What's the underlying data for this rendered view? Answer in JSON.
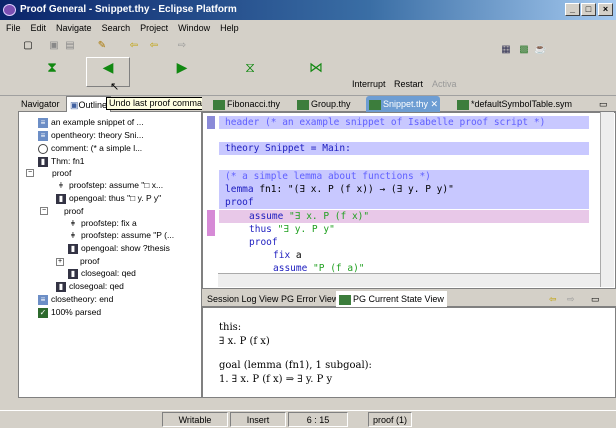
{
  "window": {
    "title": "Proof General - Snippet.thy - Eclipse Platform"
  },
  "menu": [
    "File",
    "Edit",
    "Navigate",
    "Search",
    "Project",
    "Window",
    "Help"
  ],
  "toolbar": {
    "interrupt": "Interrupt",
    "restart": "Restart",
    "activate": "Activa"
  },
  "left_tabs": {
    "navigator": "Navigator",
    "outline": "Outline"
  },
  "tooltip": "Undo last proof command",
  "outline": [
    "an example snippet of ...",
    "opentheory: theory Sni...",
    "comment: (* a simple l...",
    "Thm: fn1",
    "proof",
    "proofstep: assume \"□ x...",
    "opengoal: thus \"□ y. P y\"",
    "proof",
    "proofstep: fix a",
    "proofstep: assume \"P (...",
    "opengoal: show ?thesis",
    "proof",
    "closegoal: qed",
    "closegoal: qed",
    "closetheory: end",
    "100% parsed"
  ],
  "editor_tabs": [
    "Fibonacci.thy",
    "Group.thy",
    "Snippet.thy",
    "*defaultSymbolTable.sym"
  ],
  "editor_close": "✕",
  "code": {
    "l1": "header (* an example snippet of Isabelle proof script *)",
    "l2": "theory Snippet = Main:",
    "l3": "(* a simple lemma about functions *)",
    "l4a": "lemma",
    "l4b": " fn1: \"(∃ x. P (f x)) → (∃ y. P y)\"",
    "l5": "proof",
    "l6a": "assume",
    "l6b": " \"∃ x. P (f x)\"",
    "l7a": "thus",
    "l7b": " \"∃ y. P y\"",
    "l8": "proof",
    "l9a": "fix",
    "l9b": " a",
    "l10a": "assume",
    "l10b": " \"P (f a)\""
  },
  "bottom_tabs": [
    "Session Log View",
    "PG Error View",
    "PG Current State View"
  ],
  "state": {
    "l1": "this:",
    "l2": "∃ x. P (f x)",
    "l3": "goal (lemma (fn1), 1 subgoal):",
    "l4": "1. ∃ x. P (f x) ⇒ ∃ y. P y"
  },
  "status": {
    "writable": "Writable",
    "insert": "Insert",
    "position": "6 : 15",
    "proof": "proof (1)"
  }
}
